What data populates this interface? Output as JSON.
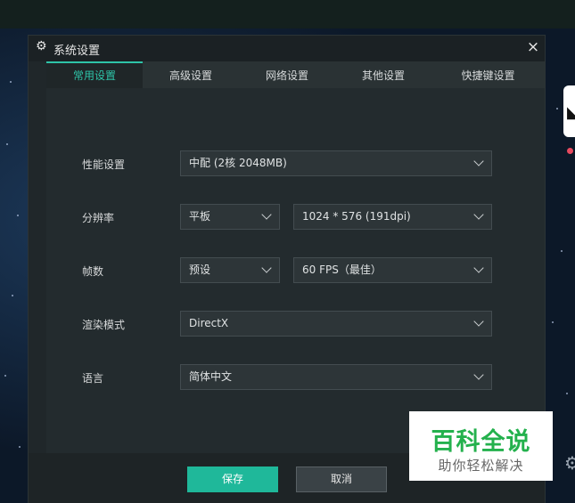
{
  "window": {
    "title": "系统设置",
    "close_glyph": "×"
  },
  "tabs": [
    {
      "label": "常用设置",
      "active": true
    },
    {
      "label": "高级设置",
      "active": false
    },
    {
      "label": "网络设置",
      "active": false
    },
    {
      "label": "其他设置",
      "active": false
    },
    {
      "label": "快捷键设置",
      "active": false
    }
  ],
  "settings": {
    "performance": {
      "label": "性能设置",
      "value": "中配 (2核 2048MB)"
    },
    "resolution": {
      "label": "分辨率",
      "mode": "平板",
      "value": "1024 * 576 (191dpi)"
    },
    "fps": {
      "label": "帧数",
      "mode": "预设",
      "value": "60 FPS（最佳）"
    },
    "render": {
      "label": "渲染模式",
      "value": "DirectX"
    },
    "language": {
      "label": "语言",
      "value": "简体中文"
    }
  },
  "footer": {
    "save_label": "保存",
    "cancel_label": "取消"
  },
  "watermark": {
    "title": "百科全说",
    "subtitle": "助你轻松解决"
  },
  "colors": {
    "accent": "#2ec4a8",
    "primary_button": "#1fb89a",
    "watermark_green": "#24b14d"
  },
  "icons": {
    "title": "gear-icon",
    "close": "close-icon",
    "dropdown": "chevron-down-icon"
  }
}
